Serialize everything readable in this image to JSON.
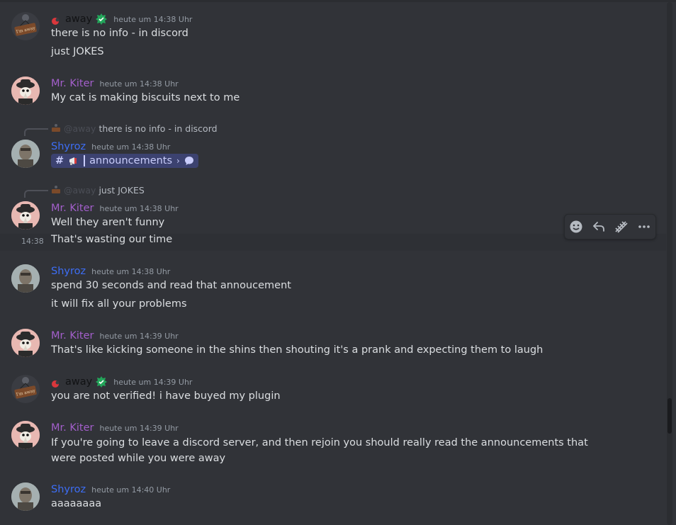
{
  "colors": {
    "background": "#313338",
    "text": "#dbdee1",
    "timestamp": "#949ba4",
    "kiter_name": "#a35fcb",
    "shyroz_name": "#3d6ef5",
    "away_name": "#111214",
    "channel_pill": "#3c4270",
    "badge_green": "#23a55a",
    "status_red": "#da373c"
  },
  "messages": [
    {
      "author": "away",
      "timestamp": "heute um 14:38 Uhr",
      "lines": [
        "there is no info - in discord",
        "just JOKES"
      ]
    },
    {
      "author": "Mr. Kiter",
      "timestamp": "heute um 14:38 Uhr",
      "lines": [
        "My cat is making biscuits next to me"
      ]
    },
    {
      "reply": {
        "mention": "@away",
        "text": "there is no info - in discord"
      },
      "author": "Shyroz",
      "timestamp": "heute um 14:38 Uhr",
      "channel": {
        "hash": "#",
        "name": "announcements",
        "chevron": "›"
      }
    },
    {
      "reply": {
        "mention": "@away",
        "text": "just JOKES"
      },
      "author": "Mr. Kiter",
      "timestamp": "heute um 14:38 Uhr",
      "lines": [
        "Well they aren't funny",
        "That's wasting our time"
      ],
      "hover_timestamp": "14:38"
    },
    {
      "author": "Shyroz",
      "timestamp": "heute um 14:38 Uhr",
      "lines": [
        "spend 30 seconds and read that annoucement",
        "it will fix all your problems"
      ]
    },
    {
      "author": "Mr. Kiter",
      "timestamp": "heute um 14:39 Uhr",
      "lines": [
        "That's like kicking someone in the shins then shouting it's a prank and expecting them to laugh"
      ]
    },
    {
      "author": "away",
      "timestamp": "heute um 14:39 Uhr",
      "lines": [
        "you are not verified! i have buyed my plugin"
      ]
    },
    {
      "author": "Mr. Kiter",
      "timestamp": "heute um 14:39 Uhr",
      "lines": [
        "If you're going to leave a discord server, and then rejoin you should really read the announcements that were posted while you were away"
      ]
    },
    {
      "author": "Shyroz",
      "timestamp": "heute um 14:40 Uhr",
      "lines": [
        "aaaaaaaa"
      ]
    }
  ],
  "toolbar": {
    "icons": [
      "add-reaction-icon",
      "reply-icon",
      "forward-icon",
      "more-options-icon"
    ]
  }
}
